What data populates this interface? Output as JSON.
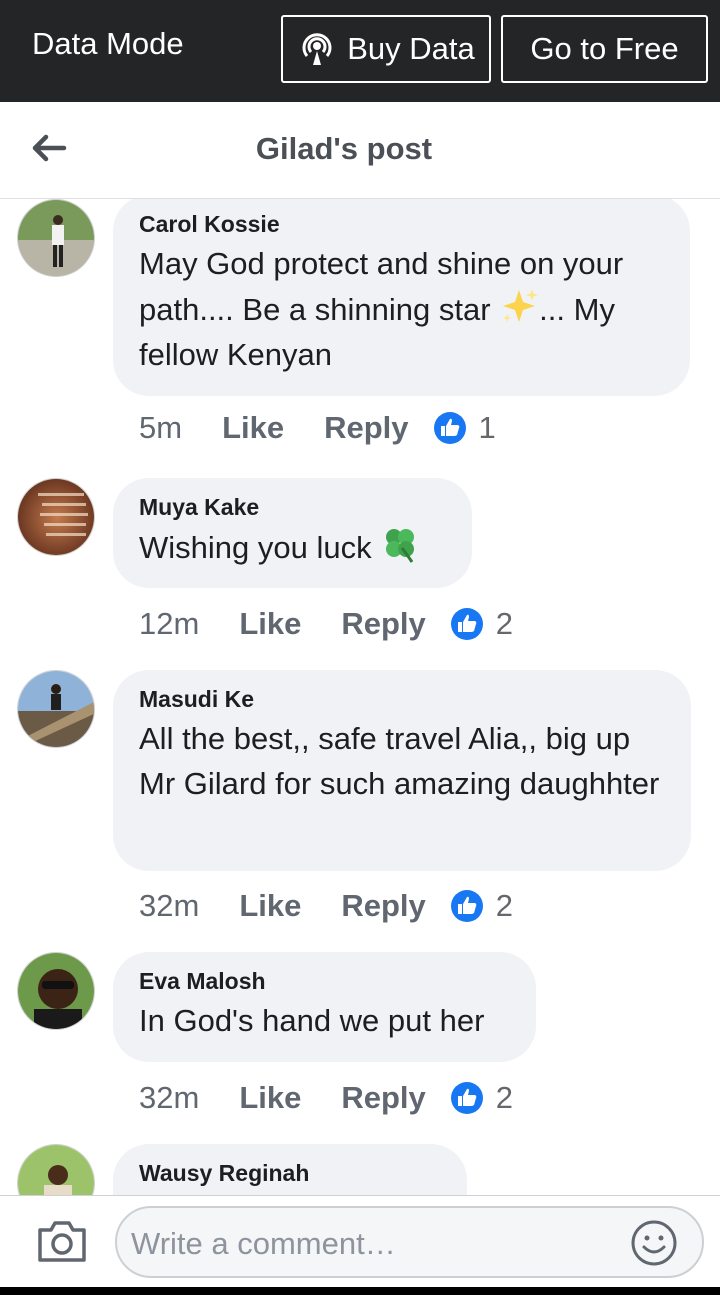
{
  "topbar": {
    "mode_label": "Data Mode",
    "buy_label": "Buy Data",
    "free_label": "Go to Free"
  },
  "header": {
    "title": "Gilad's post",
    "back_icon": "arrow-left-icon"
  },
  "comments": [
    {
      "name": "Carol Kossie",
      "text_before": "May God protect and shine on your path.... Be a shinning star ",
      "emoji": "sparkles",
      "text_after": "... My fellow Kenyan",
      "time": "5m",
      "like": "Like",
      "reply": "Reply",
      "reactions": "1"
    },
    {
      "name": "Muya Kake",
      "text_before": "Wishing you luck ",
      "emoji": "four-leaf-clover",
      "text_after": "",
      "time": "12m",
      "like": "Like",
      "reply": "Reply",
      "reactions": "2"
    },
    {
      "name": "Masudi Ke",
      "text_before": "All the best,, safe travel Alia,, big up Mr Gilard for such amazing daughhter",
      "emoji": "",
      "text_after": "",
      "time": "32m",
      "like": "Like",
      "reply": "Reply",
      "reactions": "2"
    },
    {
      "name": "Eva Malosh",
      "text_before": "In God's hand we put her",
      "emoji": "",
      "text_after": "",
      "time": "32m",
      "like": "Like",
      "reply": "Reply",
      "reactions": "2"
    },
    {
      "name": "Wausy Reginah"
    }
  ],
  "composer": {
    "placeholder": "Write a comment…",
    "camera_icon": "camera-icon",
    "emoji_icon": "smiley-icon"
  },
  "colors": {
    "like_blue": "#1877f2",
    "bubble_bg": "#f0f2f5",
    "topbar_bg": "#242526"
  }
}
